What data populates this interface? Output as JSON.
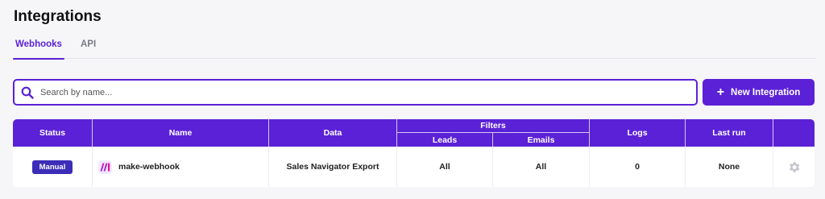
{
  "page": {
    "title": "Integrations"
  },
  "tabs": [
    {
      "label": "Webhooks",
      "active": true
    },
    {
      "label": "API",
      "active": false
    }
  ],
  "search": {
    "placeholder": "Search by name...",
    "value": ""
  },
  "new_button": {
    "label": "New Integration",
    "icon": "plus-icon"
  },
  "table": {
    "headers": {
      "status": "Status",
      "name": "Name",
      "data": "Data",
      "filters": "Filters",
      "leads": "Leads",
      "emails": "Emails",
      "logs": "Logs",
      "last_run": "Last run"
    },
    "rows": [
      {
        "status": "Manual",
        "name": "make-webhook",
        "name_icon": "make-logo-icon",
        "data": "Sales Navigator Export",
        "leads": "All",
        "emails": "All",
        "logs": "0",
        "last_run": "None",
        "action_icon": "gear-icon"
      }
    ]
  },
  "colors": {
    "accent": "#5b21d6",
    "badge": "#3b2db8",
    "background": "#f6f6f9"
  }
}
